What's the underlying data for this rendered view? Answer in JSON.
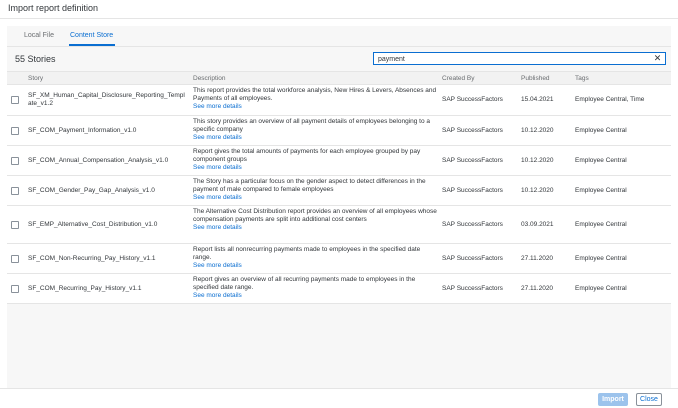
{
  "dialog": {
    "title": "Import report definition"
  },
  "tabs": [
    {
      "label": "Local File"
    },
    {
      "label": "Content Store"
    }
  ],
  "toolbar": {
    "story_count": "55 Stories",
    "search_value": "payment",
    "clear_icon": "✕"
  },
  "table": {
    "headers": {
      "story": "Story",
      "description": "Description",
      "created_by": "Created By",
      "published": "Published",
      "tags": "Tags"
    },
    "see_more_label": "See more details",
    "rows": [
      {
        "story": "SF_XM_Human_Capital_Disclosure_Reporting_Template_v1.2",
        "description": "This report provides the total workforce analysis, New Hires & Levers, Absences and Payments of all employees.",
        "created_by": "SAP SuccessFactors",
        "published": "15.04.2021",
        "tags": "Employee Central, Time"
      },
      {
        "story": "SF_COM_Payment_Information_v1.0",
        "description": "This story provides an overview of all payment details of employees belonging to a specific company",
        "created_by": "SAP SuccessFactors",
        "published": "10.12.2020",
        "tags": "Employee Central"
      },
      {
        "story": "SF_COM_Annual_Compensation_Analysis_v1.0",
        "description": "Report gives the total amounts of payments for each employee grouped by pay component groups",
        "created_by": "SAP SuccessFactors",
        "published": "10.12.2020",
        "tags": "Employee Central"
      },
      {
        "story": "SF_COM_Gender_Pay_Gap_Analysis_v1.0",
        "description": "The Story has a particular focus on the gender aspect to detect differences in the payment of male compared to female employees",
        "created_by": "SAP SuccessFactors",
        "published": "10.12.2020",
        "tags": "Employee Central"
      },
      {
        "story": "SF_EMP_Alternative_Cost_Distribution_v1.0",
        "description": "The Alternative Cost Distribution report provides an overview of all employees whose compensation payments are split into additional cost centers",
        "created_by": "SAP SuccessFactors",
        "published": "03.09.2021",
        "tags": "Employee Central"
      },
      {
        "story": "SF_COM_Non-Recurring_Pay_History_v1.1",
        "description": "Report lists all nonrecurring payments made to employees in the specified date range.",
        "created_by": "SAP SuccessFactors",
        "published": "27.11.2020",
        "tags": "Employee Central"
      },
      {
        "story": "SF_COM_Recurring_Pay_History_v1.1",
        "description": "Report gives an overview of all recurring payments made to employees in the specified date range.",
        "created_by": "SAP SuccessFactors",
        "published": "27.11.2020",
        "tags": "Employee Central"
      }
    ]
  },
  "footer": {
    "import_label": "Import",
    "close_label": "Close"
  },
  "colors": {
    "accent": "#0a6ed1",
    "disabled_button": "#9cc3ec"
  }
}
